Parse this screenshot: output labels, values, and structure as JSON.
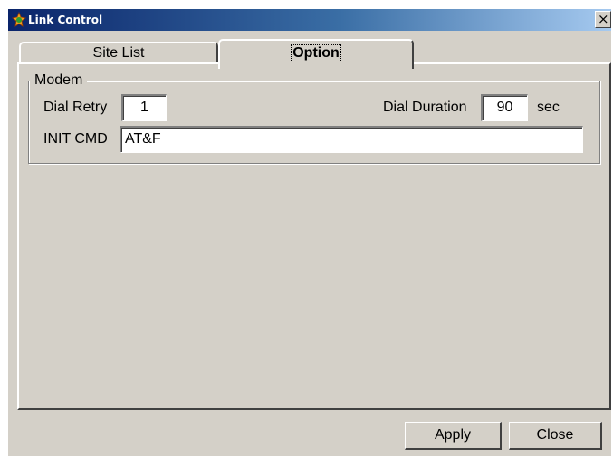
{
  "window": {
    "title": "Link Control",
    "close_glyph": "×"
  },
  "tabs": [
    {
      "label": "Site List",
      "selected": false
    },
    {
      "label": "Option",
      "selected": true
    }
  ],
  "modem": {
    "group_label": "Modem",
    "dial_retry_label": "Dial Retry",
    "dial_retry_value": "1",
    "dial_duration_label": "Dial Duration",
    "dial_duration_value": "90",
    "dial_duration_unit": "sec",
    "init_cmd_label": "INIT CMD",
    "init_cmd_value": "AT&F"
  },
  "buttons": {
    "apply": "Apply",
    "close": "Close"
  },
  "icons": {
    "app": "link-app-icon",
    "close": "close-icon"
  },
  "colors": {
    "titlebar_start": "#0a246a",
    "titlebar_end": "#a6caf0",
    "face": "#d4d0c8"
  }
}
